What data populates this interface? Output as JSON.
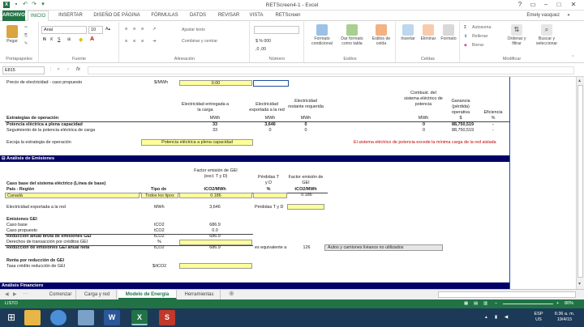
{
  "window": {
    "title": "RETScreen4-1 - Excel",
    "user": "Emely vasquez"
  },
  "ribbon_tabs": [
    "ARCHIVO",
    "INICIO",
    "INSERTAR",
    "DISEÑO DE PÁGINA",
    "FÓRMULAS",
    "DATOS",
    "REVISAR",
    "VISTA",
    "RETScreen"
  ],
  "ribbon": {
    "paste": "Pegar",
    "clipboard": "Portapapeles",
    "font_name": "Arial",
    "font_size": "10",
    "font_group": "Fuente",
    "wrap_text": "Ajustar texto",
    "merge": "Combinar y centrar",
    "alignment": "Alineación",
    "number": "Número",
    "cond_format": "Formato condicional",
    "table_format": "Dar formato como tabla",
    "cell_styles": "Estilos de celda",
    "styles": "Estilos",
    "insert": "Insertar",
    "delete": "Eliminar",
    "format": "Formato",
    "cells": "Celdas",
    "autosum": "Autosuma",
    "fill": "Rellenar",
    "clear": "Borrar",
    "sort": "Ordenar y filtrar",
    "find": "Buscar y seleccionar",
    "modify": "Modificar"
  },
  "formula_bar": {
    "cell_ref": "E815",
    "fx": "fx",
    "value": ""
  },
  "sheet": {
    "precio_label": "Precio de electricidad - caso propuesto",
    "precio_unit": "$/MWh",
    "precio_value": "0.00",
    "hdr_entregada": "Electricidad entregada a la carga",
    "hdr_exportada": "Electricidad exportada a la red",
    "hdr_restante": "Electricidad restante requerida",
    "hdr_combust": "Combust. del sistema eléctrico de potencia",
    "hdr_ganancia": "Ganancia (pérdida) operativa",
    "hdr_eficiencia": "Eficiencia",
    "estrategias": "Estrategias de operación",
    "units": [
      "MWh",
      "MWh",
      "MWh",
      "MWh",
      "$",
      "%"
    ],
    "row1": {
      "label": "Potencia eléctrica a plena capacidad",
      "v1": "33",
      "v2": "3,646",
      "v3": "0",
      "v4": "0",
      "v5": "88,750,519",
      "v6": "-"
    },
    "row2": {
      "label": "Seguimiento de la potencia eléctrica de carga",
      "v1": "33",
      "v2": "0",
      "v3": "0",
      "v4": "0",
      "v5": "88,750,519",
      "v6": "-"
    },
    "escoja_label": "Escoja la estrategia de operación",
    "escoja_value": "Potencia eléctrica a plena capacidad",
    "warning": "El sistema eléctrico de potencia excede la mínima carga de la red aislada",
    "analisis_emisiones": "Análisis de Emisiones",
    "hdr_factor": "Factor emisión de GEI (excl. T y D)",
    "hdr_perdidas": "Pérdidas T y D",
    "hdr_factor2": "Factor emisión de GEI",
    "caso_base": "Caso base del sistema eléctrico (Línea de base)",
    "pais_region": "País - Región",
    "tipo_de": "Tipo de",
    "unit_tco2": "tCO2/MWh",
    "unit_pct": "%",
    "unit_tco2b": "tCO2/MWh",
    "canada": "Canadá",
    "todos_tipos": "Todos los tipos",
    "factor_val": "0.186",
    "factor2_val": "0.186",
    "export_label": "Electricidad exportada a la red",
    "export_unit": "MWh",
    "export_val": "3,646",
    "perdidas_label": "Pérdidas T y D",
    "emisiones_gei": "Emisiones GEI",
    "caso_base2": "Caso base",
    "caso_base2_unit": "tCO2",
    "caso_base2_val": "686.9",
    "caso_prop": "Caso propuesto",
    "caso_prop_unit": "tCO2",
    "caso_prop_val": "0.0",
    "reduccion_bruta": "Reducción anual bruta de emisiones GEI",
    "reduccion_bruta_unit": "tCO2",
    "reduccion_bruta_val": "686.9",
    "derechos": "Derechos de transacción por créditos GEI",
    "derechos_unit": "%",
    "reduccion_neta": "Reducción de emisiones GEI anual neta",
    "reduccion_neta_unit": "tCO2",
    "reduccion_neta_val": "686.9",
    "equivalente": "es equivalente a",
    "equivalente_val": "126",
    "autos": "Autos y camiones livianos no utilizados",
    "renta": "Renta por reducción de GEI",
    "tasa": "Tasa crédito reducción de GEI",
    "tasa_unit": "$/tCO2",
    "analisis_financiero": "Análisis Financiero"
  },
  "sheet_tabs": [
    "Comenzar",
    "Carga y red",
    "Modelo de Energía",
    "Herramientas"
  ],
  "status": {
    "ready": "LISTO",
    "zoom": "80%"
  },
  "taskbar": {
    "lang": "ESP",
    "region": "US",
    "time": "6:36 a. m.",
    "date": "19/4/15"
  },
  "colors": {
    "excel_green": "#217346",
    "band": "#000066",
    "input_yellow": "#ffff99",
    "taskbar": "#1c3a57",
    "warning_red": "#c00000"
  }
}
